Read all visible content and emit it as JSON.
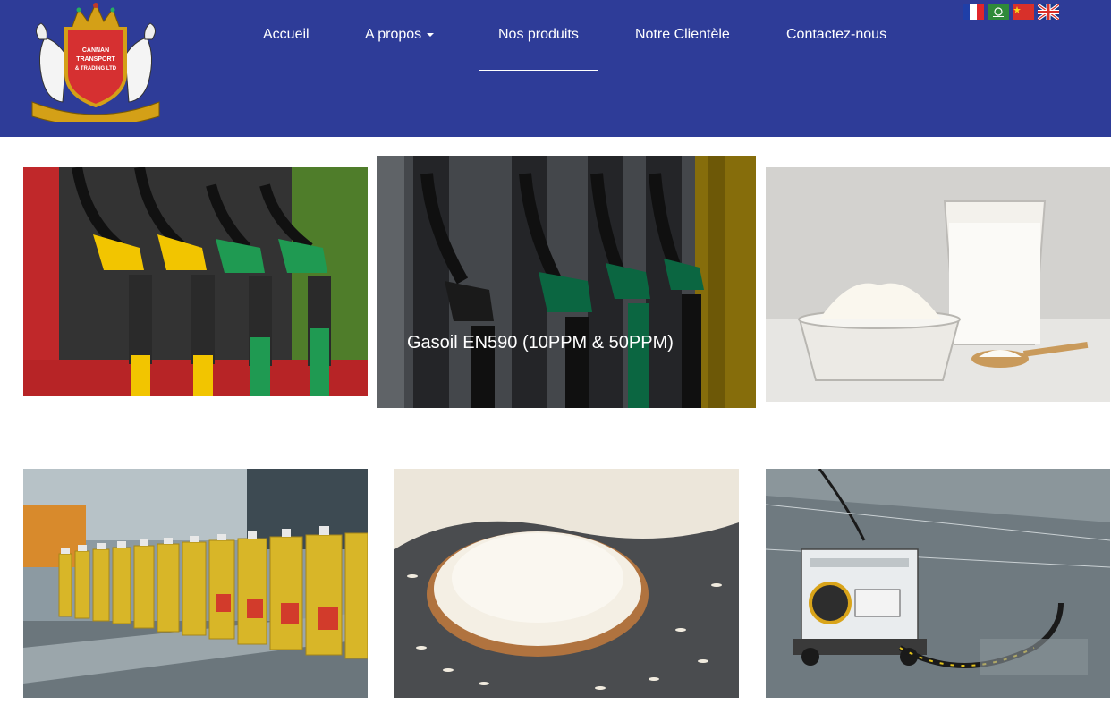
{
  "logo": {
    "text_line1": "CANNAN",
    "text_line2": "TRANSPORT",
    "text_line3": "& TRADING LTD"
  },
  "nav": {
    "items": [
      {
        "label": "Accueil"
      },
      {
        "label": "A propos",
        "has_dropdown": true
      },
      {
        "label": "Nos produits",
        "active": true
      },
      {
        "label": "Notre Clientèle"
      },
      {
        "label": "Contactez-nous"
      }
    ]
  },
  "languages": [
    {
      "code": "fr",
      "icon": "flag-france-icon"
    },
    {
      "code": "ar",
      "icon": "flag-saudi-icon"
    },
    {
      "code": "zh",
      "icon": "flag-china-icon"
    },
    {
      "code": "en",
      "icon": "flag-uk-icon"
    }
  ],
  "products": [
    {
      "image": "fuel-pumps-photo"
    },
    {
      "image": "diesel-pumps-photo",
      "caption": "Gasoil EN590 (10PPM & 50PPM)"
    },
    {
      "image": "milk-powder-photo"
    },
    {
      "image": "vegetable-oil-bottles-photo"
    },
    {
      "image": "rice-bowl-photo"
    },
    {
      "image": "aircraft-fuel-truck-photo"
    }
  ],
  "colors": {
    "header_bg": "#2e3c98",
    "nav_text": "#ffffff"
  }
}
